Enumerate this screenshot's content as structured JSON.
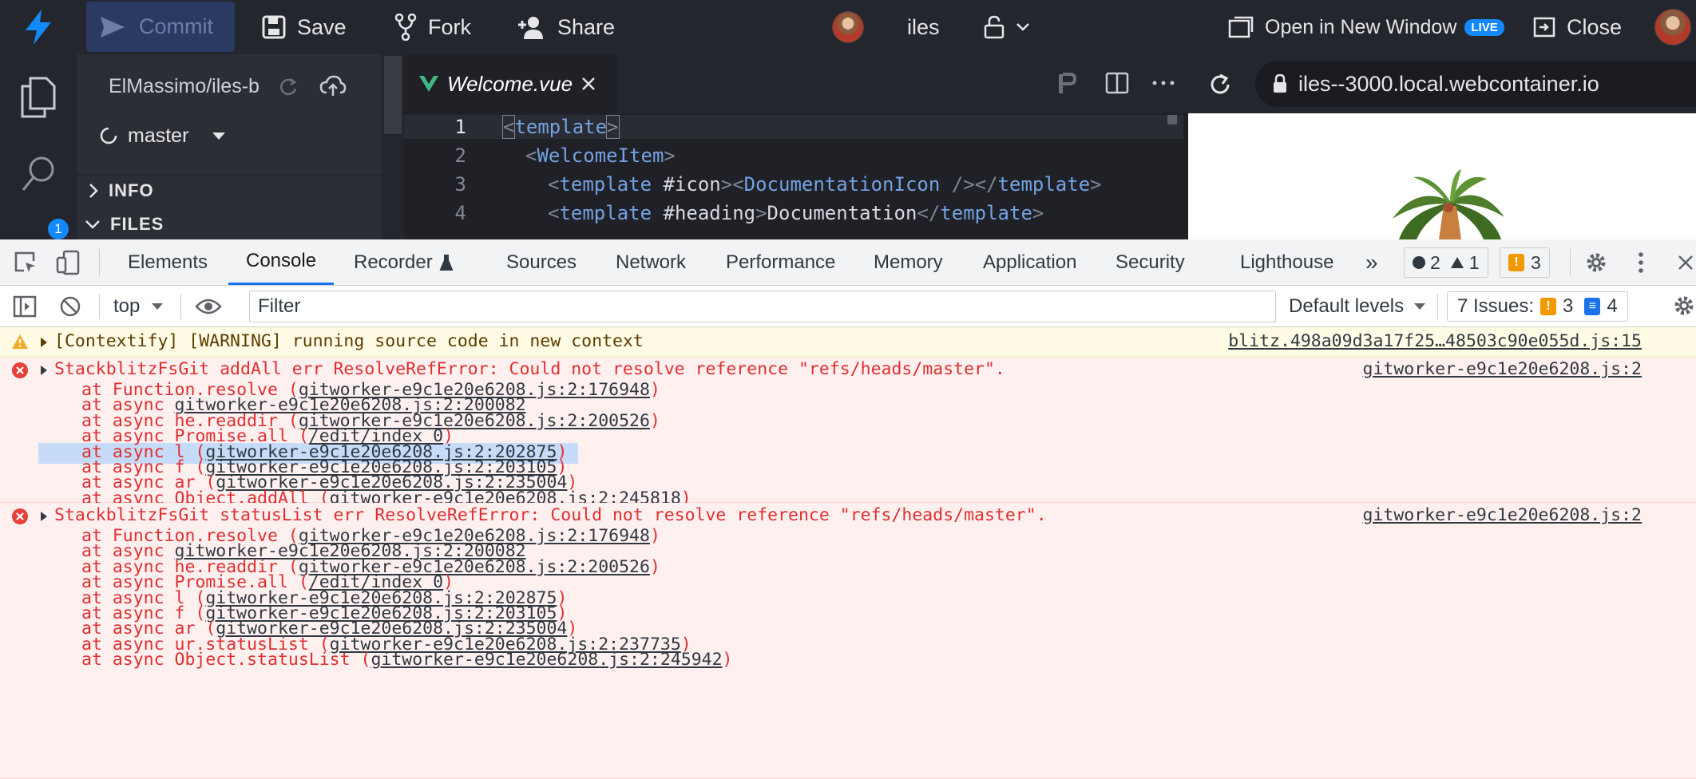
{
  "topbar": {
    "commit_label": "Commit",
    "save_label": "Save",
    "fork_label": "Fork",
    "share_label": "Share",
    "project_name": "iles",
    "open_new_window_label": "Open in New Window",
    "live_badge": "LIVE",
    "close_label": "Close"
  },
  "explorer": {
    "repo_name": "ElMassimo/iles-b",
    "branch": "master",
    "sections": [
      {
        "label": "INFO"
      },
      {
        "label": "FILES"
      }
    ],
    "activity_badge": "1"
  },
  "editor": {
    "tab_label": "Welcome.vue",
    "lines": [
      {
        "n": "1"
      },
      {
        "n": "2"
      },
      {
        "n": "3"
      },
      {
        "n": "4"
      }
    ],
    "tokens": {
      "template": "template",
      "welcome_item": "WelcomeItem",
      "icon_slot": "#icon",
      "doc_icon": "DocumentationIcon",
      "heading_slot": "#heading",
      "heading_text": "Documentation"
    }
  },
  "preview": {
    "url": "iles--3000.local.webcontainer.io"
  },
  "devtools": {
    "tabs": [
      {
        "label": "Elements"
      },
      {
        "label": "Console"
      },
      {
        "label": "Recorder"
      },
      {
        "label": "Sources"
      },
      {
        "label": "Network"
      },
      {
        "label": "Performance"
      },
      {
        "label": "Memory"
      },
      {
        "label": "Application"
      },
      {
        "label": "Security"
      },
      {
        "label": "Lighthouse"
      }
    ],
    "error_count": "2",
    "warning_count": "1",
    "issue_badge_count": "3",
    "context": "top",
    "filter_placeholder": "Filter",
    "levels": "Default levels",
    "issues_label": "7 Issues:",
    "issues_warn": "3",
    "issues_info": "4"
  },
  "console": {
    "warning": {
      "text": "[Contextify] [WARNING] running source code in new context",
      "source": "blitz.498a09d3a17f25…48503c90e055d.js:15"
    },
    "errors": [
      {
        "message": "StackblitzFsGit addAll err ResolveRefError: Could not resolve reference \"refs/heads/master\".",
        "source": "gitworker-e9c1e20e6208.js:2",
        "stack": [
          {
            "pre": "at Function.resolve (",
            "link": "gitworker-e9c1e20e6208.js:2:176948",
            "post": ")"
          },
          {
            "pre": "at async ",
            "link": "gitworker-e9c1e20e6208.js:2:200082",
            "post": ""
          },
          {
            "pre": "at async he.readdir (",
            "link": "gitworker-e9c1e20e6208.js:2:200526",
            "post": ")"
          },
          {
            "pre": "at async Promise.all (",
            "link": "/edit/index 0",
            "post": ")"
          },
          {
            "pre": "at async l (",
            "link": "gitworker-e9c1e20e6208.js:2:202875",
            "post": ")"
          },
          {
            "pre": "at async f (",
            "link": "gitworker-e9c1e20e6208.js:2:203105",
            "post": ")"
          },
          {
            "pre": "at async ar (",
            "link": "gitworker-e9c1e20e6208.js:2:235004",
            "post": ")"
          },
          {
            "pre": "at async Object.addAll (",
            "link": "gitworker-e9c1e20e6208.js:2:245818",
            "post": ")"
          }
        ]
      },
      {
        "message": "StackblitzFsGit statusList err ResolveRefError: Could not resolve reference \"refs/heads/master\".",
        "source": "gitworker-e9c1e20e6208.js:2",
        "stack": [
          {
            "pre": "at Function.resolve (",
            "link": "gitworker-e9c1e20e6208.js:2:176948",
            "post": ")"
          },
          {
            "pre": "at async ",
            "link": "gitworker-e9c1e20e6208.js:2:200082",
            "post": ""
          },
          {
            "pre": "at async he.readdir (",
            "link": "gitworker-e9c1e20e6208.js:2:200526",
            "post": ")"
          },
          {
            "pre": "at async Promise.all (",
            "link": "/edit/index 0",
            "post": ")"
          },
          {
            "pre": "at async l (",
            "link": "gitworker-e9c1e20e6208.js:2:202875",
            "post": ")"
          },
          {
            "pre": "at async f (",
            "link": "gitworker-e9c1e20e6208.js:2:203105",
            "post": ")"
          },
          {
            "pre": "at async ar (",
            "link": "gitworker-e9c1e20e6208.js:2:235004",
            "post": ")"
          },
          {
            "pre": "at async ur.statusList (",
            "link": "gitworker-e9c1e20e6208.js:2:237735",
            "post": ")"
          },
          {
            "pre": "at async Object.statusList (",
            "link": "gitworker-e9c1e20e6208.js:2:245942",
            "post": ")"
          }
        ]
      }
    ]
  },
  "colors": {
    "brand": "#1389fd",
    "error": "#e02f2f",
    "warning_bg": "#fffbe5",
    "error_bg": "#fff0f0",
    "selection": "#c5dbf7",
    "devtools_accent": "#1a73e8"
  }
}
